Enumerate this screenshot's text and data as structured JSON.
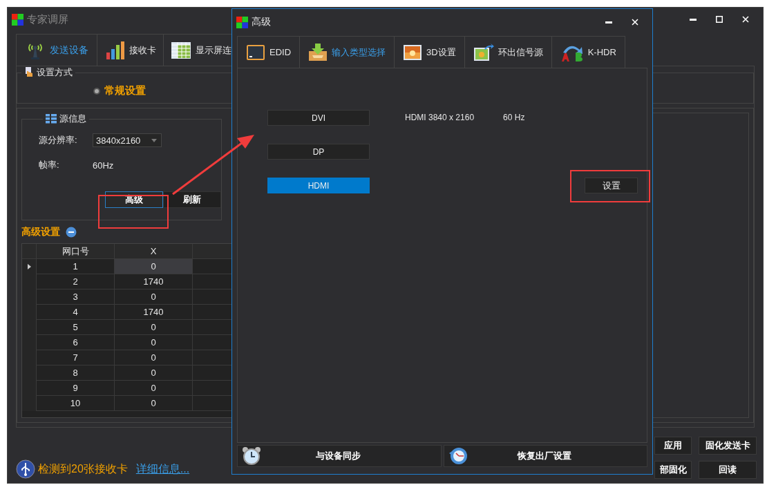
{
  "main_window": {
    "title": "专家调屏",
    "tabs": [
      {
        "label": "发送设备",
        "selected": true
      },
      {
        "label": "接收卡",
        "selected": false
      },
      {
        "label": "显示屏连",
        "selected": false
      }
    ]
  },
  "setting_mode": {
    "title": "设置方式",
    "option": {
      "label": "常规设置",
      "selected": true
    }
  },
  "source_info": {
    "title": "源信息",
    "resolution_label": "源分辨率:",
    "resolution": "3840x2160",
    "frame_rate_label": "帧率:",
    "frame_rate": "60Hz",
    "buttons": [
      {
        "label": "高级",
        "focused": true
      },
      {
        "label": "刷新",
        "focused": false
      }
    ]
  },
  "advanced_settings": {
    "title": "高级设置",
    "expanded": true,
    "table": {
      "columns": [
        "网口号",
        "X"
      ],
      "rows": [
        {
          "cells": [
            "1",
            "0"
          ],
          "selected": true
        },
        {
          "cells": [
            "2",
            "1740"
          ],
          "selected": false
        },
        {
          "cells": [
            "3",
            "0"
          ],
          "selected": false
        },
        {
          "cells": [
            "4",
            "1740"
          ],
          "selected": false
        },
        {
          "cells": [
            "5",
            "0"
          ],
          "selected": false
        },
        {
          "cells": [
            "6",
            "0"
          ],
          "selected": false
        },
        {
          "cells": [
            "7",
            "0"
          ],
          "selected": false
        },
        {
          "cells": [
            "8",
            "0"
          ],
          "selected": false
        },
        {
          "cells": [
            "9",
            "0"
          ],
          "selected": false
        },
        {
          "cells": [
            "10",
            "0"
          ],
          "selected": false
        }
      ]
    }
  },
  "status": {
    "message": "检测到20张接收卡",
    "link": "详细信息..."
  },
  "action_buttons": [
    "应用",
    "固化发送卡",
    "部固化",
    "回读"
  ],
  "dialog": {
    "title": "高级",
    "tabs": [
      {
        "label": "EDID",
        "selected": false
      },
      {
        "label": "输入类型选择",
        "selected": true
      },
      {
        "label": "3D设置",
        "selected": false
      },
      {
        "label": "环出信号源",
        "selected": false
      },
      {
        "label": "K-HDR",
        "selected": false
      }
    ],
    "input_types": [
      {
        "label": "DVI",
        "selected": false
      },
      {
        "label": "DP",
        "selected": false
      },
      {
        "label": "HDMI",
        "selected": true
      }
    ],
    "signal": "HDMI 3840 x 2160",
    "refresh": "60 Hz",
    "settings_button": "设置",
    "footer_buttons": [
      "与设备同步",
      "恢复出厂设置"
    ]
  }
}
